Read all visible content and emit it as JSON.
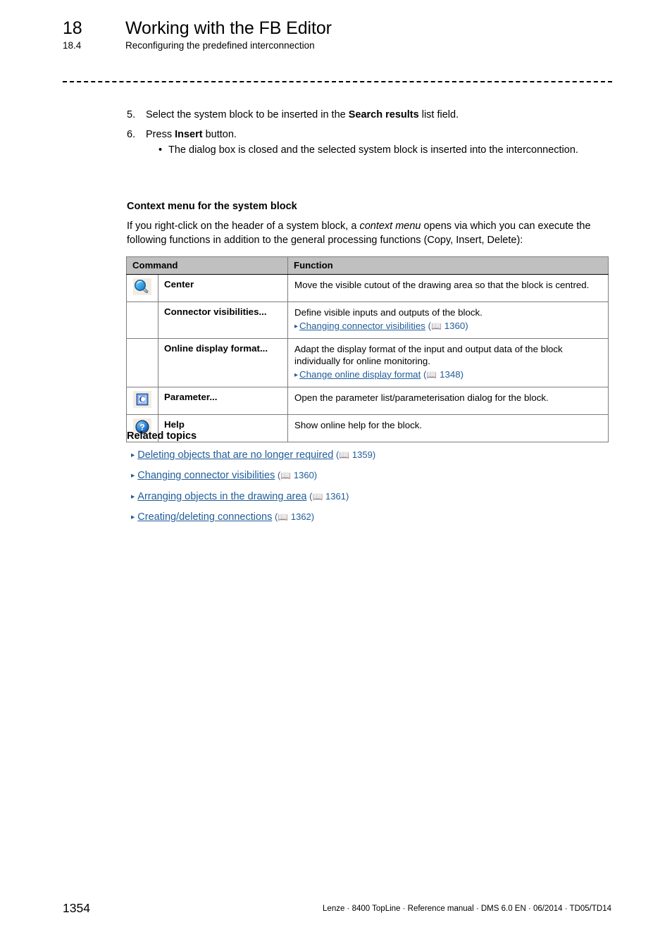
{
  "header": {
    "chapter_number": "18",
    "chapter_title": "Working with the FB Editor",
    "section_number": "18.4",
    "section_title": "Reconfiguring the predefined interconnection"
  },
  "steps": [
    {
      "number": "5.",
      "text_before": "Select the system block to be inserted in the ",
      "bold": "Search results",
      "text_after": " list field."
    },
    {
      "number": "6.",
      "text_before": "Press ",
      "bold": "Insert",
      "text_after": " button.",
      "sub_bullets": [
        {
          "marker": "•",
          "text": "The dialog box is closed and the selected system block is inserted into the interconnection."
        }
      ]
    }
  ],
  "context_section": {
    "heading": "Context menu for the system block",
    "paragraph_part1": "If you right-click on the header of a system block, a ",
    "paragraph_italic": "context menu",
    "paragraph_part2": " opens via which you can execute the following functions in addition to the general processing functions (Copy, Insert, Delete):"
  },
  "table": {
    "columns": [
      "Command",
      "Function"
    ],
    "rows": [
      {
        "icon": "magnifier-icon",
        "command": "Center",
        "function_lines": [
          "Move the visible cutout of the drawing area so that the block is centred."
        ],
        "xref": null
      },
      {
        "icon": null,
        "command": "Connector visibilities...",
        "function_lines": [
          "Define visible inputs and outputs of the block."
        ],
        "xref": {
          "arrow": "▸",
          "link": "Changing connector visibilities",
          "book": "📖",
          "page": "1360"
        }
      },
      {
        "icon": null,
        "command": "Online display format...",
        "function_lines": [
          "Adapt the display format of the input and output data of the block",
          "individually for online monitoring."
        ],
        "xref": {
          "arrow": "▸",
          "link": "Change online display format",
          "book": "📖",
          "page": "1348"
        }
      },
      {
        "icon": "parameter-c-icon",
        "command": "Parameter...",
        "function_lines": [
          "Open the parameter list/parameterisation dialog for the block."
        ],
        "xref": null
      },
      {
        "icon": "help-question-icon",
        "command": "Help",
        "function_lines": [
          "Show online help for the block."
        ],
        "xref": null
      }
    ]
  },
  "related_topics": {
    "heading": "Related topics",
    "items": [
      {
        "arrow": "▸",
        "link": "Deleting objects that are no longer required",
        "book": "📖",
        "page": "1359"
      },
      {
        "arrow": "▸",
        "link": "Changing connector visibilities",
        "book": "📖",
        "page": "1360"
      },
      {
        "arrow": "▸",
        "link": "Arranging objects in the drawing area",
        "book": "📖",
        "page": "1361"
      },
      {
        "arrow": "▸",
        "link": "Creating/deleting connections",
        "book": "📖",
        "page": "1362"
      }
    ]
  },
  "footer": {
    "page_number": "1354",
    "meta": "Lenze · 8400 TopLine · Reference manual · DMS 6.0 EN · 06/2014 · TD05/TD14"
  },
  "colors": {
    "link": "#1f5c99",
    "table_header_bg": "#c0c0c0",
    "icon_bg": "#f2ede1",
    "text": "#000000"
  }
}
